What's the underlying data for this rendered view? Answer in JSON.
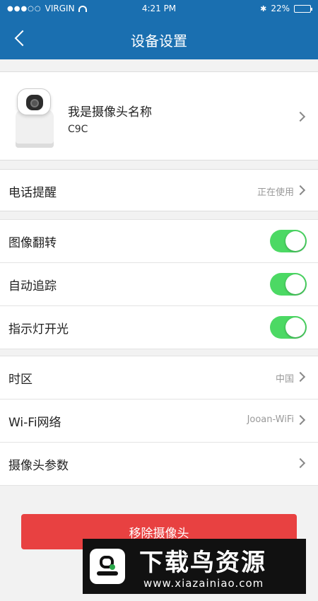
{
  "status_bar": {
    "signal": "●●●○○",
    "carrier": "VIRGIN",
    "time": "4:21 PM",
    "bluetooth": "✱",
    "battery_text": "22%",
    "battery_level": 0.22
  },
  "nav": {
    "title": "设备设置"
  },
  "device": {
    "name": "我是摄像头名称",
    "model": "C9C"
  },
  "rows": {
    "phone_alert": {
      "label": "电话提醒",
      "value": "正在使用"
    },
    "image_flip": {
      "label": "图像翻转",
      "on": true
    },
    "auto_tracking": {
      "label": "自动追踪",
      "on": true
    },
    "indicator_light": {
      "label": "指示灯开光",
      "on": true
    },
    "timezone": {
      "label": "时区",
      "value": "中国"
    },
    "wifi": {
      "label": "Wi-Fi网络",
      "value": "Jooan-WiFi"
    },
    "camera_params": {
      "label": "摄像头参数"
    }
  },
  "remove_button": {
    "label": "移除摄像头"
  },
  "watermark": {
    "title": "下载鸟资源",
    "url": "www.xiazainiao.com"
  },
  "colors": {
    "header": "#1a6fb0",
    "toggle_on": "#4cd964",
    "danger": "#e84141"
  }
}
